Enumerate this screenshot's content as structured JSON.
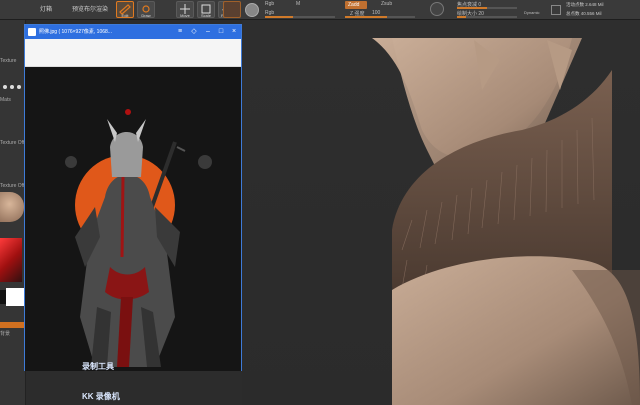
{
  "menu": {
    "item1": "灯箱",
    "item2": "预览布尔渲染"
  },
  "toolbar": {
    "edit": "Edit",
    "draw": "Draw",
    "move": "Move",
    "scale": "Scale",
    "rotate": "Rotate"
  },
  "params": {
    "rgb": "Rgb",
    "mrgb": "M",
    "rgb_intensity": "Rgb",
    "zadd": "Zadd",
    "zsub": "Zsub",
    "z_intensity": "Z 强度",
    "z_intensity_value": "100",
    "focal_shift": "焦点衰减 0",
    "draw_size": "绘制大小 20",
    "dynamic": "Dynamic"
  },
  "info": {
    "active_points": "活动点数 2.648 Mil",
    "total_points": "总点数 40.556 Mil"
  },
  "leftstrip": {
    "label1": "Texture",
    "label2": "Mats",
    "label3": "Texture Off",
    "label4": "Texture Off",
    "label5": "背景"
  },
  "viewer": {
    "title": "照佛.jpg ( 1076×927像素, 1068..."
  },
  "watermark": {
    "line1": "录制工具",
    "line2": "KK 录像机"
  },
  "colors": {
    "accent": "#e07a20",
    "titlebar": "#2e6fe0"
  }
}
